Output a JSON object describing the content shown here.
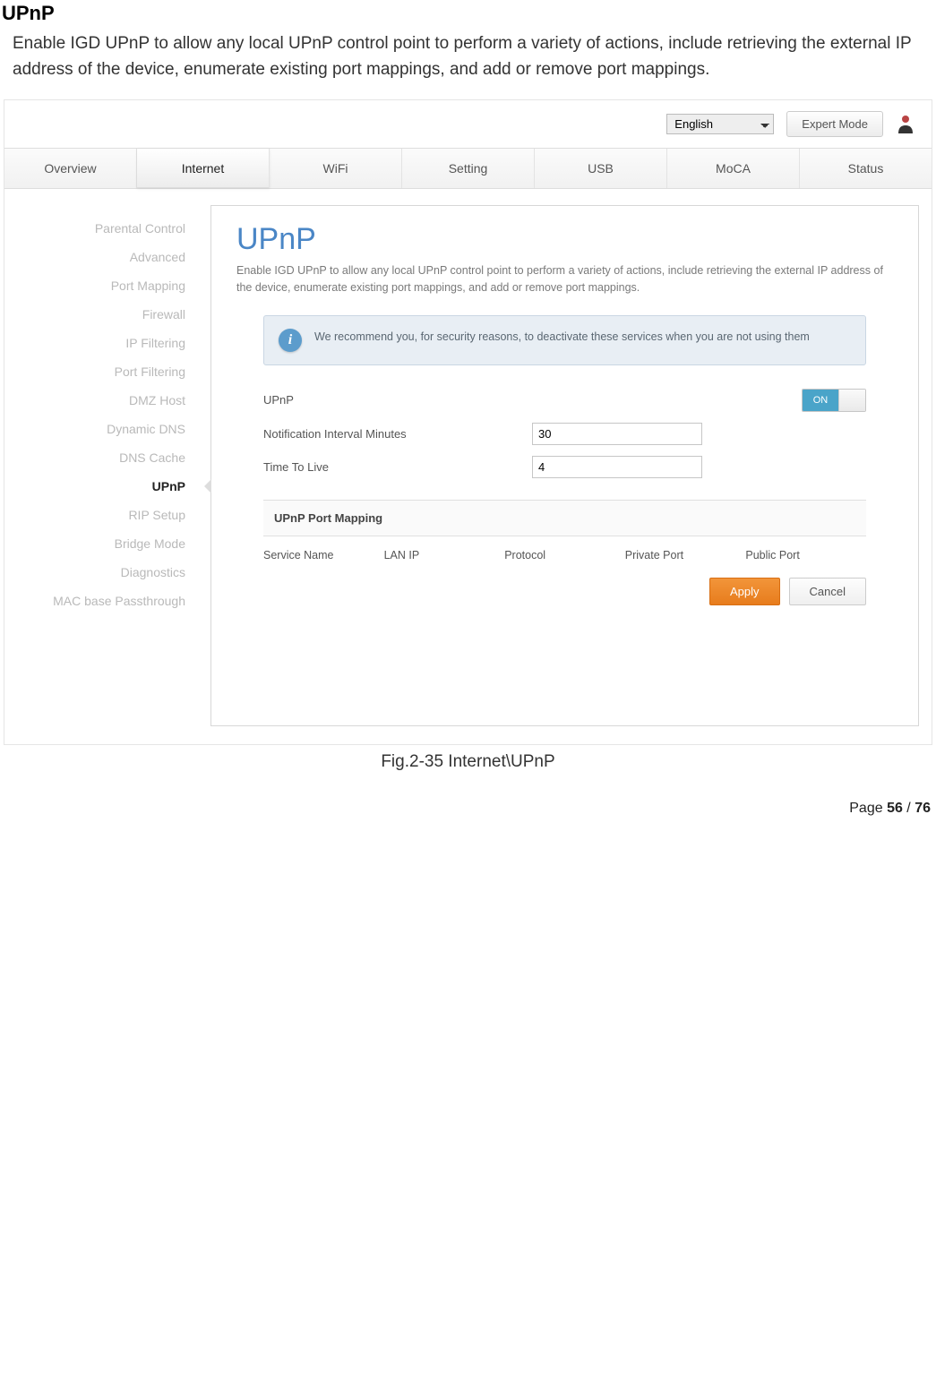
{
  "doc": {
    "heading": "UPnP",
    "intro": "Enable IGD UPnP to allow any local UPnP control point to perform a variety of actions, include retrieving the external IP address of the device, enumerate existing port mappings, and add or remove port mappings.",
    "figure_caption": "Fig.2-35 Internet\\UPnP",
    "page_prefix": "Page ",
    "page_current": "56",
    "page_sep": " / ",
    "page_total": "76"
  },
  "topbar": {
    "language": "English",
    "expert_mode": "Expert Mode"
  },
  "tabs": [
    "Overview",
    "Internet",
    "WiFi",
    "Setting",
    "USB",
    "MoCA",
    "Status"
  ],
  "active_tab_index": 1,
  "sidemenu": {
    "items": [
      "Parental Control",
      "Advanced",
      "Port Mapping",
      "Firewall",
      "IP Filtering",
      "Port Filtering",
      "DMZ Host",
      "Dynamic DNS",
      "DNS Cache",
      "UPnP",
      "RIP Setup",
      "Bridge Mode",
      "Diagnostics",
      "MAC base Passthrough"
    ],
    "active_index": 9
  },
  "panel": {
    "title": "UPnP",
    "desc": "Enable IGD UPnP to allow any local UPnP control point to perform a variety of actions, include retrieving the external IP address of the device, enumerate existing port mappings, and add or remove port mappings.",
    "info_banner": "We recommend you, for security reasons, to deactivate these services when you are not using them",
    "fields": {
      "upnp_label": "UPnP",
      "upnp_toggle": "ON",
      "interval_label": "Notification Interval Minutes",
      "interval_value": "30",
      "ttl_label": "Time To Live",
      "ttl_value": "4"
    },
    "port_section_title": "UPnP Port Mapping",
    "port_headers": [
      "Service Name",
      "LAN IP",
      "Protocol",
      "Private Port",
      "Public Port"
    ],
    "apply": "Apply",
    "cancel": "Cancel"
  }
}
